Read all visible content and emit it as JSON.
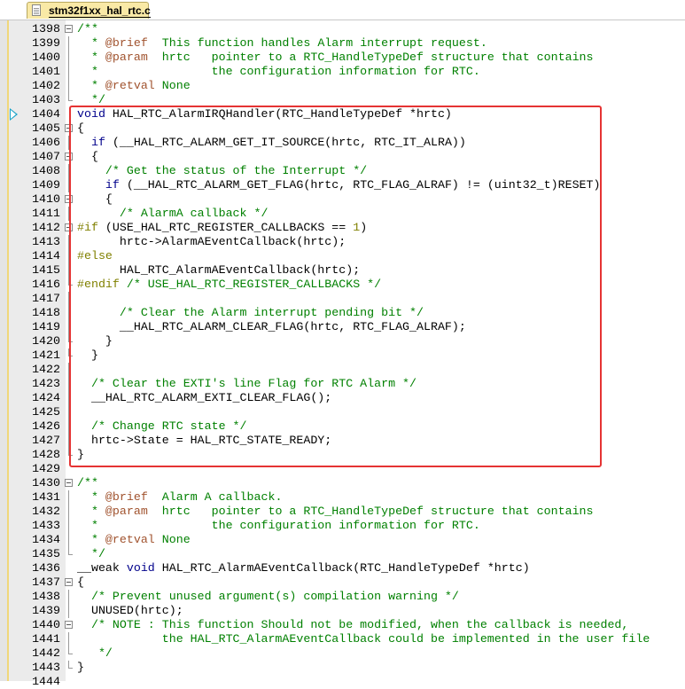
{
  "tab": {
    "label": "stm32f1xx_hal_rtc.c"
  },
  "current_line": 1404,
  "colors": {
    "comment": "#008000",
    "keyword": "#00008b",
    "doctag": "#a0522d",
    "preprocessor": "#808000",
    "highlight_box": "#e53333"
  },
  "lines": [
    {
      "n": "1398",
      "f": "box",
      "s": [
        [
          "c",
          "/**"
        ]
      ]
    },
    {
      "n": "1399",
      "f": "line",
      "s": [
        [
          "c",
          "  * "
        ],
        [
          "d",
          "@brief"
        ],
        [
          "c",
          "  This function handles Alarm interrupt request."
        ]
      ]
    },
    {
      "n": "1400",
      "f": "line",
      "s": [
        [
          "c",
          "  * "
        ],
        [
          "d",
          "@param"
        ],
        [
          "c",
          "  hrtc   pointer to a RTC_HandleTypeDef structure that contains"
        ]
      ]
    },
    {
      "n": "1401",
      "f": "line",
      "s": [
        [
          "c",
          "  *                the configuration information for RTC."
        ]
      ]
    },
    {
      "n": "1402",
      "f": "line",
      "s": [
        [
          "c",
          "  * "
        ],
        [
          "d",
          "@retval"
        ],
        [
          "c",
          " None"
        ]
      ]
    },
    {
      "n": "1403",
      "f": "end",
      "s": [
        [
          "c",
          "  */"
        ]
      ]
    },
    {
      "n": "1404",
      "f": "",
      "s": [
        [
          "k",
          "void"
        ],
        [
          "t",
          " HAL_RTC_AlarmIRQHandler(RTC_HandleTypeDef *hrtc)"
        ]
      ]
    },
    {
      "n": "1405",
      "f": "box",
      "s": [
        [
          "t",
          "{"
        ]
      ]
    },
    {
      "n": "1406",
      "f": "line",
      "s": [
        [
          "t",
          "  "
        ],
        [
          "k",
          "if"
        ],
        [
          "t",
          " (__HAL_RTC_ALARM_GET_IT_SOURCE(hrtc, RTC_IT_ALRA))"
        ]
      ]
    },
    {
      "n": "1407",
      "f": "box",
      "s": [
        [
          "t",
          "  {"
        ]
      ]
    },
    {
      "n": "1408",
      "f": "line",
      "s": [
        [
          "c",
          "    /* Get the status of the Interrupt */"
        ]
      ]
    },
    {
      "n": "1409",
      "f": "line",
      "s": [
        [
          "t",
          "    "
        ],
        [
          "k",
          "if"
        ],
        [
          "t",
          " (__HAL_RTC_ALARM_GET_FLAG(hrtc, RTC_FLAG_ALRAF) != (uint32_t)RESET)"
        ]
      ]
    },
    {
      "n": "1410",
      "f": "box",
      "s": [
        [
          "t",
          "    {"
        ]
      ]
    },
    {
      "n": "1411",
      "f": "line",
      "s": [
        [
          "c",
          "      /* AlarmA callback */"
        ]
      ]
    },
    {
      "n": "1412",
      "f": "box",
      "s": [
        [
          "p",
          "#if"
        ],
        [
          "t",
          " (USE_HAL_RTC_REGISTER_CALLBACKS == "
        ],
        [
          "n",
          "1"
        ],
        [
          "t",
          ")"
        ]
      ]
    },
    {
      "n": "1413",
      "f": "line",
      "s": [
        [
          "t",
          "      hrtc->AlarmAEventCallback(hrtc);"
        ]
      ]
    },
    {
      "n": "1414",
      "f": "line",
      "s": [
        [
          "p",
          "#else"
        ]
      ]
    },
    {
      "n": "1415",
      "f": "line",
      "s": [
        [
          "t",
          "      HAL_RTC_AlarmAEventCallback(hrtc);"
        ]
      ]
    },
    {
      "n": "1416",
      "f": "end",
      "s": [
        [
          "p",
          "#endif"
        ],
        [
          "c",
          " /* USE_HAL_RTC_REGISTER_CALLBACKS */"
        ]
      ]
    },
    {
      "n": "1417",
      "f": "line",
      "s": [
        [
          "t",
          ""
        ]
      ]
    },
    {
      "n": "1418",
      "f": "line",
      "s": [
        [
          "c",
          "      /* Clear the Alarm interrupt pending bit */"
        ]
      ]
    },
    {
      "n": "1419",
      "f": "line",
      "s": [
        [
          "t",
          "      __HAL_RTC_ALARM_CLEAR_FLAG(hrtc, RTC_FLAG_ALRAF);"
        ]
      ]
    },
    {
      "n": "1420",
      "f": "end",
      "s": [
        [
          "t",
          "    }"
        ]
      ]
    },
    {
      "n": "1421",
      "f": "end",
      "s": [
        [
          "t",
          "  }"
        ]
      ]
    },
    {
      "n": "1422",
      "f": "line",
      "s": [
        [
          "t",
          ""
        ]
      ]
    },
    {
      "n": "1423",
      "f": "line",
      "s": [
        [
          "c",
          "  /* Clear the EXTI's line Flag for RTC Alarm */"
        ]
      ]
    },
    {
      "n": "1424",
      "f": "line",
      "s": [
        [
          "t",
          "  __HAL_RTC_ALARM_EXTI_CLEAR_FLAG();"
        ]
      ]
    },
    {
      "n": "1425",
      "f": "line",
      "s": [
        [
          "t",
          ""
        ]
      ]
    },
    {
      "n": "1426",
      "f": "line",
      "s": [
        [
          "c",
          "  /* Change RTC state */"
        ]
      ]
    },
    {
      "n": "1427",
      "f": "line",
      "s": [
        [
          "t",
          "  hrtc->State = HAL_RTC_STATE_READY;"
        ]
      ]
    },
    {
      "n": "1428",
      "f": "end",
      "s": [
        [
          "t",
          "}"
        ]
      ]
    },
    {
      "n": "1429",
      "f": "",
      "s": [
        [
          "t",
          ""
        ]
      ]
    },
    {
      "n": "1430",
      "f": "box",
      "s": [
        [
          "c",
          "/**"
        ]
      ]
    },
    {
      "n": "1431",
      "f": "line",
      "s": [
        [
          "c",
          "  * "
        ],
        [
          "d",
          "@brief"
        ],
        [
          "c",
          "  Alarm A callback."
        ]
      ]
    },
    {
      "n": "1432",
      "f": "line",
      "s": [
        [
          "c",
          "  * "
        ],
        [
          "d",
          "@param"
        ],
        [
          "c",
          "  hrtc   pointer to a RTC_HandleTypeDef structure that contains"
        ]
      ]
    },
    {
      "n": "1433",
      "f": "line",
      "s": [
        [
          "c",
          "  *                the configuration information for RTC."
        ]
      ]
    },
    {
      "n": "1434",
      "f": "line",
      "s": [
        [
          "c",
          "  * "
        ],
        [
          "d",
          "@retval"
        ],
        [
          "c",
          " None"
        ]
      ]
    },
    {
      "n": "1435",
      "f": "end",
      "s": [
        [
          "c",
          "  */"
        ]
      ]
    },
    {
      "n": "1436",
      "f": "",
      "s": [
        [
          "t",
          "__weak "
        ],
        [
          "k",
          "void"
        ],
        [
          "t",
          " HAL_RTC_AlarmAEventCallback(RTC_HandleTypeDef *hrtc)"
        ]
      ]
    },
    {
      "n": "1437",
      "f": "box",
      "s": [
        [
          "t",
          "{"
        ]
      ]
    },
    {
      "n": "1438",
      "f": "line",
      "s": [
        [
          "c",
          "  /* Prevent unused argument(s) compilation warning */"
        ]
      ]
    },
    {
      "n": "1439",
      "f": "line",
      "s": [
        [
          "t",
          "  UNUSED(hrtc);"
        ]
      ]
    },
    {
      "n": "1440",
      "f": "box",
      "s": [
        [
          "c",
          "  /* NOTE : This function Should not be modified, when the callback is needed,"
        ]
      ]
    },
    {
      "n": "1441",
      "f": "line",
      "s": [
        [
          "c",
          "            the HAL_RTC_AlarmAEventCallback could be implemented in the user file"
        ]
      ]
    },
    {
      "n": "1442",
      "f": "end",
      "s": [
        [
          "c",
          "   */"
        ]
      ]
    },
    {
      "n": "1443",
      "f": "end",
      "s": [
        [
          "t",
          "}"
        ]
      ]
    },
    {
      "n": "1444",
      "f": "",
      "s": [
        [
          "t",
          ""
        ]
      ]
    }
  ]
}
